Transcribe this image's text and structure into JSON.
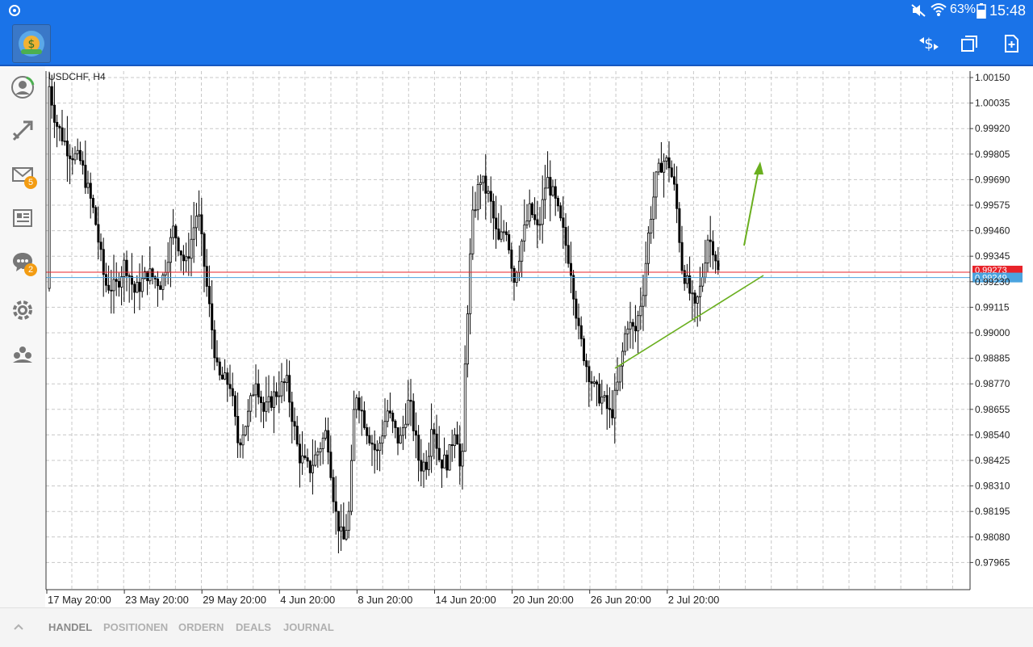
{
  "statusbar": {
    "battery": "63%",
    "time": "15:48"
  },
  "sidebar": {
    "mail_badge": "5",
    "chat_badge": "2"
  },
  "tabs": [
    "HANDEL",
    "POSITIONEN",
    "ORDERN",
    "DEALS",
    "JOURNAL"
  ],
  "chart": {
    "symbol_label": "USDCHF, H4",
    "bid_label": "0.99273",
    "ask_label": "0.99249",
    "bid_color": "#e8232a",
    "ask_color": "#4aa3df",
    "price_labels": [
      "1.00150",
      "1.00035",
      "0.99920",
      "0.99805",
      "0.99690",
      "0.99575",
      "0.99460",
      "0.99345",
      "0.99230",
      "0.99115",
      "0.99000",
      "0.98885",
      "0.98770",
      "0.98655",
      "0.98540",
      "0.98425",
      "0.98310",
      "0.98195",
      "0.98080",
      "0.97965"
    ],
    "time_labels": [
      "17 May 20:00",
      "23 May 20:00",
      "29 May 20:00",
      "4 Jun 20:00",
      "8 Jun 20:00",
      "14 Jun 20:00",
      "20 Jun 20:00",
      "26 Jun 20:00",
      "2 Jul 20:00"
    ]
  }
}
